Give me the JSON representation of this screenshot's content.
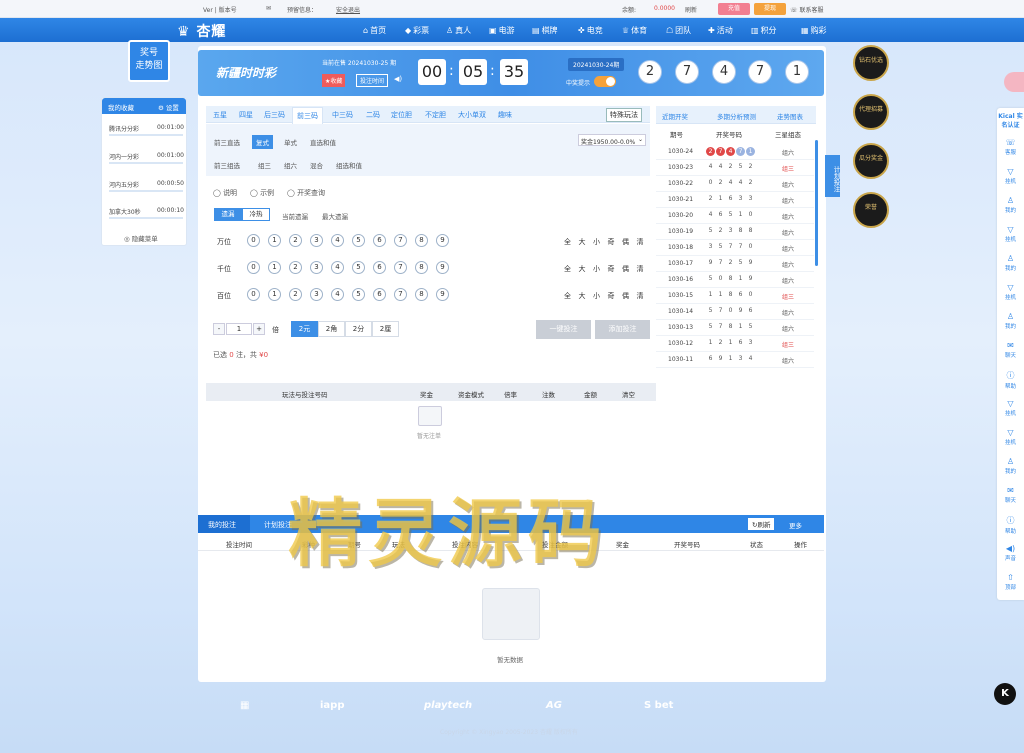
{
  "topbar": {
    "version": "Ver | 版本号",
    "msg": "预留信息：",
    "safe": "安全退出",
    "balance_label": "余额:",
    "balance": "0.0000",
    "refresh": "刷新",
    "recharge": "充值",
    "withdraw": "提现",
    "contact": "联系客服"
  },
  "nav": {
    "logo": "杏耀",
    "items": [
      "首页",
      "彩票",
      "真人",
      "电游",
      "棋牌",
      "电竞",
      "体育",
      "团队",
      "活动",
      "积分",
      "购彩"
    ]
  },
  "left": {
    "trend_btn": "奖号\n走势图",
    "fav_title": "我的收藏",
    "settings": "设置",
    "favorites": [
      {
        "name": "腾讯分分彩",
        "time": "00:01:00"
      },
      {
        "name": "河内一分彩",
        "time": "00:01:00"
      },
      {
        "name": "河内五分彩",
        "time": "00:00:50"
      },
      {
        "name": "加拿大30秒",
        "time": "00:00:10"
      }
    ],
    "hide_menu": "隐藏菜单"
  },
  "banner": {
    "game_logo": "新疆时时彩",
    "current_label": "当前在售 20241030-25 期",
    "fav": "收藏",
    "timer_label": "投注时间",
    "hh": "00",
    "mm": "05",
    "ss": "35",
    "last_issue": "20241030-24期",
    "sound": "中奖提示",
    "result": [
      "2",
      "7",
      "4",
      "7",
      "1"
    ]
  },
  "tabs": {
    "items": [
      "五星",
      "四星",
      "后三码",
      "前三码",
      "中三码",
      "二码",
      "定位胆",
      "不定胆",
      "大小单双",
      "趣味"
    ],
    "active": "前三码",
    "special": "特殊玩法"
  },
  "subtabs": {
    "row1_label": "前三直选",
    "row1": [
      "复式",
      "单式",
      "直选和值"
    ],
    "row2_label": "前三组选",
    "row2": [
      "组三",
      "组六",
      "混合",
      "组选和值"
    ],
    "odds": "奖金1950.00-0.0%"
  },
  "options": [
    "说明",
    "示例",
    "开奖查询"
  ],
  "modes": [
    "遗漏",
    "冷热"
  ],
  "mode_extra": [
    "当前遗漏",
    "最大遗漏"
  ],
  "positions": [
    "万位",
    "千位",
    "百位"
  ],
  "digits": [
    "0",
    "1",
    "2",
    "3",
    "4",
    "5",
    "6",
    "7",
    "8",
    "9"
  ],
  "quick": [
    "全",
    "大",
    "小",
    "奇",
    "偶",
    "清"
  ],
  "bet": {
    "minus": "-",
    "qty": "1",
    "plus": "+",
    "times": "倍",
    "units": [
      "2元",
      "2角",
      "2分",
      "2厘"
    ],
    "one_key": "一键投注",
    "add": "添加投注",
    "summary_prefix": "已选",
    "count": "0",
    "summary_mid": "注，共",
    "amount": "¥0"
  },
  "cart_head": [
    "玩法与投注号码",
    "奖金",
    "资金模式",
    "倍率",
    "注数",
    "金额",
    "清空"
  ],
  "cart_empty": "暂无注单",
  "history": {
    "tabs": [
      "近期开奖",
      "多期分析预测",
      "走势图表"
    ],
    "cols": [
      "期号",
      "开奖号码",
      "三星组态"
    ],
    "rows": [
      {
        "p": "1030-24",
        "d": [
          "2",
          "7",
          "4",
          "7",
          "1"
        ],
        "t": "组六"
      },
      {
        "p": "1030-23",
        "d": [
          "4",
          "4",
          "2",
          "5",
          "2"
        ],
        "t": "组三"
      },
      {
        "p": "1030-22",
        "d": [
          "0",
          "2",
          "4",
          "4",
          "2"
        ],
        "t": "组六"
      },
      {
        "p": "1030-21",
        "d": [
          "2",
          "1",
          "6",
          "3",
          "3"
        ],
        "t": "组六"
      },
      {
        "p": "1030-20",
        "d": [
          "4",
          "6",
          "5",
          "1",
          "0"
        ],
        "t": "组六"
      },
      {
        "p": "1030-19",
        "d": [
          "5",
          "2",
          "3",
          "8",
          "8"
        ],
        "t": "组六"
      },
      {
        "p": "1030-18",
        "d": [
          "3",
          "5",
          "7",
          "7",
          "0"
        ],
        "t": "组六"
      },
      {
        "p": "1030-17",
        "d": [
          "9",
          "7",
          "2",
          "5",
          "9"
        ],
        "t": "组六"
      },
      {
        "p": "1030-16",
        "d": [
          "5",
          "0",
          "8",
          "1",
          "9"
        ],
        "t": "组六"
      },
      {
        "p": "1030-15",
        "d": [
          "1",
          "1",
          "8",
          "6",
          "0"
        ],
        "t": "组三"
      },
      {
        "p": "1030-14",
        "d": [
          "5",
          "7",
          "0",
          "9",
          "6"
        ],
        "t": "组六"
      },
      {
        "p": "1030-13",
        "d": [
          "5",
          "7",
          "8",
          "1",
          "5"
        ],
        "t": "组六"
      },
      {
        "p": "1030-12",
        "d": [
          "1",
          "2",
          "1",
          "6",
          "3"
        ],
        "t": "组三"
      },
      {
        "p": "1030-11",
        "d": [
          "6",
          "9",
          "1",
          "3",
          "4"
        ],
        "t": "组六"
      }
    ]
  },
  "plan_tab": "计划投注",
  "records": {
    "tabs": [
      "我的投注",
      "计划投注"
    ],
    "refresh": "刷新",
    "more": "更多",
    "cols": [
      "投注时间",
      "彩种",
      "期号",
      "玩法",
      "投注内容",
      "投注金额",
      "奖金",
      "开奖号码",
      "状态",
      "操作"
    ],
    "empty": "暂无数据"
  },
  "badges": [
    "钻石优选",
    "代理招募",
    "瓜分奖金",
    "荣誉"
  ],
  "right_side": {
    "top": "Kical 实名认证",
    "items": [
      "客服",
      "挂机",
      "我的",
      "挂机",
      "我的",
      "挂机",
      "我的",
      "聊天",
      "帮助",
      "挂机",
      "挂机",
      "我的",
      "聊天",
      "帮助",
      "声音",
      "顶部"
    ]
  },
  "footer": {
    "logos": [
      "iapp",
      "playtech",
      "AG",
      "S bet"
    ],
    "copyright": "Copyright © Xingyao 2005-2023 杏耀 版权所有"
  },
  "watermark": "精灵源码",
  "colors": {
    "nav": "#2f86e6",
    "accent": "#3d8fe6",
    "red": "#e04848"
  }
}
